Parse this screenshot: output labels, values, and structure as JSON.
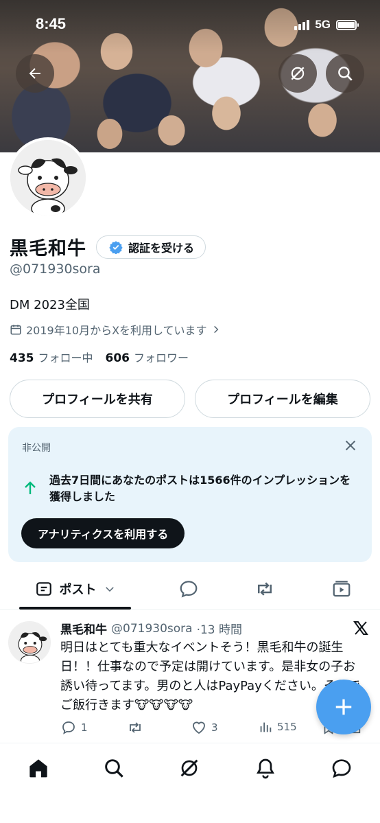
{
  "status_bar": {
    "time": "8:45",
    "network": "5G"
  },
  "profile": {
    "name": "黒毛和牛",
    "verify_label": "認証を受ける",
    "handle": "@071930sora",
    "bio": "DM 2023全国",
    "joined": "2019年10月からXを利用しています",
    "following_count": "435",
    "following_label": "フォロー中",
    "followers_count": "606",
    "followers_label": "フォロワー",
    "share_label": "プロフィールを共有",
    "edit_label": "プロフィールを編集"
  },
  "private_card": {
    "label": "非公開",
    "message": "過去7日間にあなたのポストは1566件のインプレッションを獲得しました",
    "action_label": "アナリティクスを利用する"
  },
  "tabs": {
    "posts_label": "ポスト"
  },
  "post": {
    "author": "黒毛和牛",
    "handle": "@071930sora",
    "time": "·13 時間",
    "text": "明日はとても重大なイベントそう！黒毛和牛の誕生日！！仕事なので予定は開けています。是非女の子お誘い待ってます。男のと人はPayPayください。それでご飯行きます🐮🐮🐮🐮",
    "reply_count": "1",
    "like_count": "3",
    "view_count": "515"
  },
  "colors": {
    "accent": "#4a9ff0",
    "verified": "#4a9ff0",
    "green_arrow": "#00ba7c"
  },
  "icons": [
    "back-arrow-icon",
    "grok-icon",
    "search-icon",
    "calendar-icon",
    "close-icon",
    "arrow-up-icon",
    "post-tab-icon",
    "chevron-down-icon",
    "replies-icon",
    "reposts-icon",
    "media-icon",
    "x-logo-icon",
    "reply-icon",
    "repost-icon",
    "like-icon",
    "views-icon",
    "bookmark-icon",
    "share-icon",
    "plus-icon",
    "home-icon",
    "explore-icon",
    "grok-nav-icon",
    "notifications-icon",
    "messages-icon"
  ]
}
